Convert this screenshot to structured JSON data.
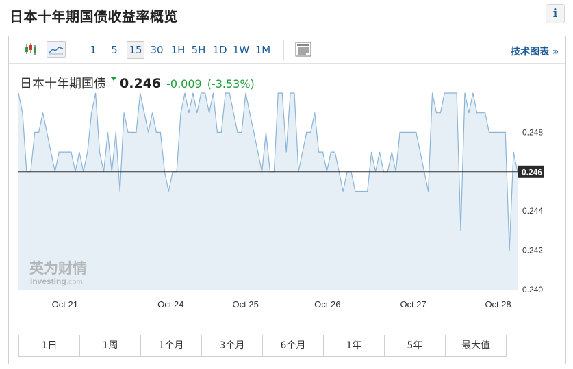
{
  "page_title": "日本十年期国债收益率概览",
  "info_label": "i",
  "toolbar": {
    "timeframes": [
      "1",
      "5",
      "15",
      "30",
      "1H",
      "5H",
      "1D",
      "1W",
      "1M"
    ],
    "active_timeframe": "15",
    "tech_chart_link": "技术图表 »"
  },
  "quote": {
    "name": "日本十年期国债",
    "price": "0.246",
    "change": "-0.009",
    "change_pct": "(-3.53%)"
  },
  "ranges": [
    "1日",
    "1周",
    "1个月",
    "3个月",
    "6个月",
    "1年",
    "5年",
    "最大值"
  ],
  "watermark": {
    "cn": "英为财情",
    "en": "Investing",
    "suffix": ".com"
  },
  "colors": {
    "line": "#8ab4d8",
    "fill": "#e6eff6",
    "down": "#1e9e3a",
    "link": "#1a5a96",
    "last_tag": "#2a2a2a"
  },
  "chart_data": {
    "type": "area",
    "title": "",
    "xlabel": "",
    "ylabel": "",
    "ylim": [
      0.24,
      0.25
    ],
    "y_ticks": [
      "0.248",
      "0.244",
      "0.242",
      "0.240"
    ],
    "last_value_label": "0.246",
    "last_value": 0.246,
    "x_ticks": [
      "Oct 21",
      "Oct 24",
      "Oct 25",
      "Oct 26",
      "Oct 27",
      "Oct 28"
    ],
    "grid": false,
    "values": [
      0.25,
      0.249,
      0.246,
      0.246,
      0.248,
      0.248,
      0.249,
      0.248,
      0.247,
      0.246,
      0.247,
      0.247,
      0.247,
      0.247,
      0.246,
      0.247,
      0.246,
      0.247,
      0.249,
      0.25,
      0.247,
      0.246,
      0.248,
      0.246,
      0.248,
      0.245,
      0.249,
      0.248,
      0.248,
      0.248,
      0.25,
      0.249,
      0.248,
      0.249,
      0.248,
      0.248,
      0.246,
      0.245,
      0.246,
      0.246,
      0.249,
      0.25,
      0.249,
      0.25,
      0.249,
      0.25,
      0.25,
      0.249,
      0.25,
      0.248,
      0.248,
      0.25,
      0.25,
      0.249,
      0.248,
      0.248,
      0.25,
      0.249,
      0.248,
      0.247,
      0.246,
      0.248,
      0.246,
      0.246,
      0.25,
      0.25,
      0.247,
      0.25,
      0.25,
      0.246,
      0.247,
      0.248,
      0.248,
      0.249,
      0.247,
      0.247,
      0.246,
      0.247,
      0.247,
      0.246,
      0.245,
      0.246,
      0.246,
      0.245,
      0.245,
      0.245,
      0.245,
      0.247,
      0.246,
      0.247,
      0.246,
      0.246,
      0.247,
      0.246,
      0.248,
      0.248,
      0.248,
      0.248,
      0.248,
      0.247,
      0.246,
      0.245,
      0.25,
      0.249,
      0.249,
      0.25,
      0.25,
      0.25,
      0.25,
      0.243,
      0.25,
      0.249,
      0.25,
      0.249,
      0.249,
      0.249,
      0.248,
      0.248,
      0.248,
      0.248,
      0.248,
      0.242,
      0.247,
      0.246
    ]
  }
}
